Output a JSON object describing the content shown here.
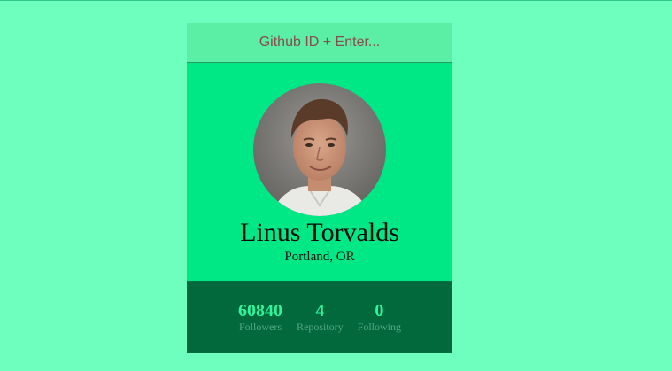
{
  "search": {
    "placeholder": "Github ID + Enter..."
  },
  "profile": {
    "name": "Linus Torvalds",
    "location": "Portland, OR"
  },
  "stats": [
    {
      "value": "60840",
      "label": "Followers"
    },
    {
      "value": "4",
      "label": "Repository"
    },
    {
      "value": "0",
      "label": "Following"
    }
  ],
  "colors": {
    "page_background": "#6effbf",
    "card_background": "#00e785",
    "search_background": "#5beea5",
    "stats_background": "#02693d",
    "stat_value": "#2ff59a",
    "stat_label": "#55a886"
  }
}
